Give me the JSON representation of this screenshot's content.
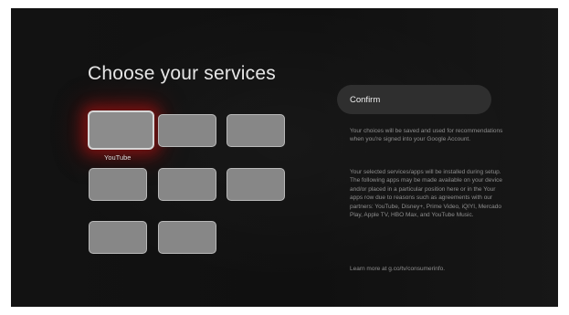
{
  "screen": {
    "title": "Choose your services",
    "focused_tile_label": "YouTube",
    "confirm_label": "Confirm",
    "info": {
      "p1": "Your choices will be saved and used for recommendations when you're signed into your Google Account.",
      "p2": "Your selected services/apps will be installed during setup. The following apps may be made available on your device and/or placed in a particular position here or in the Your apps row due to reasons such as agreements with our partners: YouTube, Disney+, Prime Video, iQIYI, Mercado Play, Apple TV, HBO Max, and YouTube Music.",
      "p3": "Learn more at g.co/tv/consumerinfo."
    }
  },
  "colors": {
    "background": "#121212",
    "tile": "#878787",
    "focus_glow": "#aa1414",
    "confirm_bg": "#2f2f2f"
  }
}
